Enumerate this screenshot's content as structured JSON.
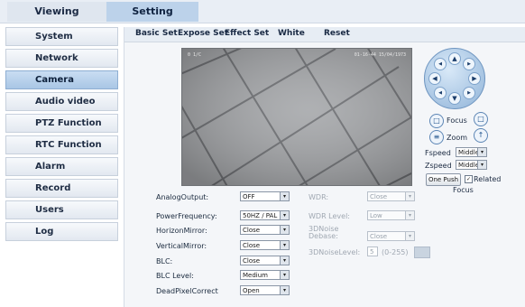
{
  "top_tabs": {
    "viewing": "Viewing",
    "setting": "Setting"
  },
  "sidebar": {
    "items": [
      {
        "label": "System"
      },
      {
        "label": "Network"
      },
      {
        "label": "Camera"
      },
      {
        "label": "Audio video"
      },
      {
        "label": "PTZ Function"
      },
      {
        "label": "RTC Function"
      },
      {
        "label": "Alarm"
      },
      {
        "label": "Record"
      },
      {
        "label": "Users"
      },
      {
        "label": "Log"
      }
    ],
    "active": "Camera"
  },
  "sub_tabs": {
    "basic": "Basic Set",
    "expose": "Expose Set",
    "effect": "Effect Set",
    "white": "White",
    "reset": "Reset"
  },
  "video": {
    "osd_left": "0 1/C",
    "osd_right": "01-16-44 15/04/1973"
  },
  "ptz": {
    "focus_label": "Focus",
    "zoom_label": "Zoom",
    "fspeed_label": "Fspeed",
    "fspeed_value": "Middle",
    "zspeed_label": "Zspeed",
    "zspeed_value": "Middle",
    "one_push_label": "One Push",
    "related_label": "Related",
    "focus_caption": "Focus",
    "related_checked": "✓"
  },
  "settings_left": [
    {
      "label": "AnalogOutput:",
      "value": "OFF"
    },
    {
      "label": "PowerFrequency:",
      "value": "50HZ / PAL"
    },
    {
      "label": "HorizonMirror:",
      "value": "Close"
    },
    {
      "label": "VerticalMirror:",
      "value": "Close"
    },
    {
      "label": "BLC:",
      "value": "Close"
    },
    {
      "label": "BLC Level:",
      "value": "Medium"
    },
    {
      "label": "DeadPixelCorrect",
      "value": "Open"
    }
  ],
  "settings_right": [
    {
      "label": "WDR:",
      "value": "Close"
    },
    {
      "label": "WDR Level:",
      "value": "Low"
    },
    {
      "label": "3DNoise Debase:",
      "value": "Close"
    },
    {
      "label": "3DNoiseLevel:",
      "value": "5",
      "range": "(0-255)"
    }
  ],
  "colors": {
    "accent": "#bcd2ea",
    "active_side": "#a9c6e5",
    "ptz_ring": "#8fb3d8"
  },
  "icons": {
    "dropdown": "▾",
    "arrow_up": "▲",
    "arrow_down": "▼",
    "arrow_left": "◀",
    "arrow_right": "▶"
  }
}
